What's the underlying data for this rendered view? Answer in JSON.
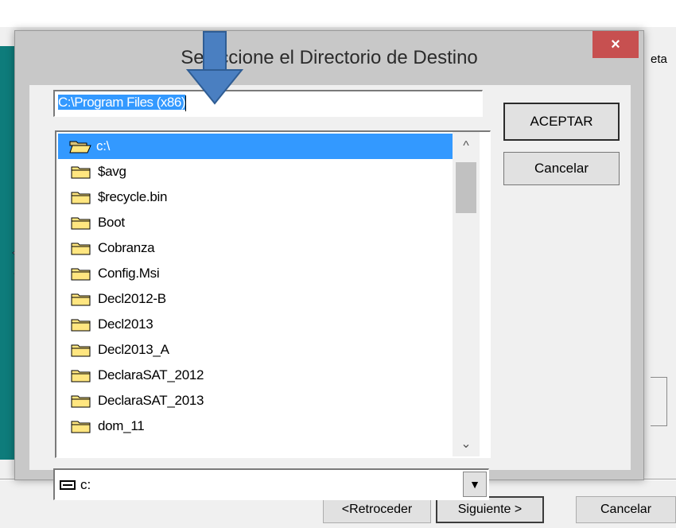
{
  "background": {
    "partial_text": "eta",
    "buttons": {
      "back": "<Retroceder",
      "next": "Siguiente >",
      "cancel": "Cancelar"
    }
  },
  "dialog": {
    "title": "Seleccione el Directorio de Destino",
    "path_value": "C:\\Program Files (x86)",
    "ok_label": "ACEPTAR",
    "cancel_label": "Cancelar",
    "folders": [
      {
        "name": "c:\\",
        "open": true,
        "selected": true
      },
      {
        "name": "$avg"
      },
      {
        "name": "$recycle.bin"
      },
      {
        "name": "Boot"
      },
      {
        "name": "Cobranza"
      },
      {
        "name": "Config.Msi"
      },
      {
        "name": "Decl2012-B"
      },
      {
        "name": "Decl2013"
      },
      {
        "name": "Decl2013_A"
      },
      {
        "name": "DeclaraSAT_2012"
      },
      {
        "name": "DeclaraSAT_2013"
      },
      {
        "name": "dom_11"
      }
    ],
    "drive": "c:",
    "close_glyph": "×"
  },
  "colors": {
    "selection": "#3399ff",
    "close_button": "#c75050",
    "folder_fill": "#ffe680",
    "arrow": "#4a7fc1",
    "left_panel": "#0e7c7b"
  }
}
